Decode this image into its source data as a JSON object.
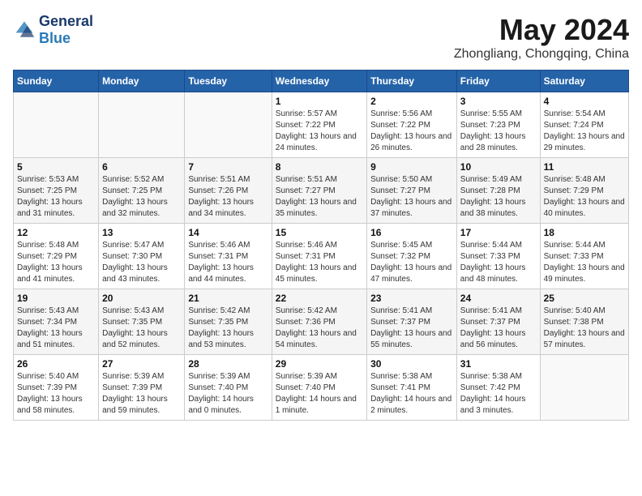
{
  "header": {
    "logo_general": "General",
    "logo_blue": "Blue",
    "month": "May 2024",
    "location": "Zhongliang, Chongqing, China"
  },
  "weekdays": [
    "Sunday",
    "Monday",
    "Tuesday",
    "Wednesday",
    "Thursday",
    "Friday",
    "Saturday"
  ],
  "weeks": [
    [
      {
        "day": "",
        "sunrise": "",
        "sunset": "",
        "daylight": ""
      },
      {
        "day": "",
        "sunrise": "",
        "sunset": "",
        "daylight": ""
      },
      {
        "day": "",
        "sunrise": "",
        "sunset": "",
        "daylight": ""
      },
      {
        "day": "1",
        "sunrise": "Sunrise: 5:57 AM",
        "sunset": "Sunset: 7:22 PM",
        "daylight": "Daylight: 13 hours and 24 minutes."
      },
      {
        "day": "2",
        "sunrise": "Sunrise: 5:56 AM",
        "sunset": "Sunset: 7:22 PM",
        "daylight": "Daylight: 13 hours and 26 minutes."
      },
      {
        "day": "3",
        "sunrise": "Sunrise: 5:55 AM",
        "sunset": "Sunset: 7:23 PM",
        "daylight": "Daylight: 13 hours and 28 minutes."
      },
      {
        "day": "4",
        "sunrise": "Sunrise: 5:54 AM",
        "sunset": "Sunset: 7:24 PM",
        "daylight": "Daylight: 13 hours and 29 minutes."
      }
    ],
    [
      {
        "day": "5",
        "sunrise": "Sunrise: 5:53 AM",
        "sunset": "Sunset: 7:25 PM",
        "daylight": "Daylight: 13 hours and 31 minutes."
      },
      {
        "day": "6",
        "sunrise": "Sunrise: 5:52 AM",
        "sunset": "Sunset: 7:25 PM",
        "daylight": "Daylight: 13 hours and 32 minutes."
      },
      {
        "day": "7",
        "sunrise": "Sunrise: 5:51 AM",
        "sunset": "Sunset: 7:26 PM",
        "daylight": "Daylight: 13 hours and 34 minutes."
      },
      {
        "day": "8",
        "sunrise": "Sunrise: 5:51 AM",
        "sunset": "Sunset: 7:27 PM",
        "daylight": "Daylight: 13 hours and 35 minutes."
      },
      {
        "day": "9",
        "sunrise": "Sunrise: 5:50 AM",
        "sunset": "Sunset: 7:27 PM",
        "daylight": "Daylight: 13 hours and 37 minutes."
      },
      {
        "day": "10",
        "sunrise": "Sunrise: 5:49 AM",
        "sunset": "Sunset: 7:28 PM",
        "daylight": "Daylight: 13 hours and 38 minutes."
      },
      {
        "day": "11",
        "sunrise": "Sunrise: 5:48 AM",
        "sunset": "Sunset: 7:29 PM",
        "daylight": "Daylight: 13 hours and 40 minutes."
      }
    ],
    [
      {
        "day": "12",
        "sunrise": "Sunrise: 5:48 AM",
        "sunset": "Sunset: 7:29 PM",
        "daylight": "Daylight: 13 hours and 41 minutes."
      },
      {
        "day": "13",
        "sunrise": "Sunrise: 5:47 AM",
        "sunset": "Sunset: 7:30 PM",
        "daylight": "Daylight: 13 hours and 43 minutes."
      },
      {
        "day": "14",
        "sunrise": "Sunrise: 5:46 AM",
        "sunset": "Sunset: 7:31 PM",
        "daylight": "Daylight: 13 hours and 44 minutes."
      },
      {
        "day": "15",
        "sunrise": "Sunrise: 5:46 AM",
        "sunset": "Sunset: 7:31 PM",
        "daylight": "Daylight: 13 hours and 45 minutes."
      },
      {
        "day": "16",
        "sunrise": "Sunrise: 5:45 AM",
        "sunset": "Sunset: 7:32 PM",
        "daylight": "Daylight: 13 hours and 47 minutes."
      },
      {
        "day": "17",
        "sunrise": "Sunrise: 5:44 AM",
        "sunset": "Sunset: 7:33 PM",
        "daylight": "Daylight: 13 hours and 48 minutes."
      },
      {
        "day": "18",
        "sunrise": "Sunrise: 5:44 AM",
        "sunset": "Sunset: 7:33 PM",
        "daylight": "Daylight: 13 hours and 49 minutes."
      }
    ],
    [
      {
        "day": "19",
        "sunrise": "Sunrise: 5:43 AM",
        "sunset": "Sunset: 7:34 PM",
        "daylight": "Daylight: 13 hours and 51 minutes."
      },
      {
        "day": "20",
        "sunrise": "Sunrise: 5:43 AM",
        "sunset": "Sunset: 7:35 PM",
        "daylight": "Daylight: 13 hours and 52 minutes."
      },
      {
        "day": "21",
        "sunrise": "Sunrise: 5:42 AM",
        "sunset": "Sunset: 7:35 PM",
        "daylight": "Daylight: 13 hours and 53 minutes."
      },
      {
        "day": "22",
        "sunrise": "Sunrise: 5:42 AM",
        "sunset": "Sunset: 7:36 PM",
        "daylight": "Daylight: 13 hours and 54 minutes."
      },
      {
        "day": "23",
        "sunrise": "Sunrise: 5:41 AM",
        "sunset": "Sunset: 7:37 PM",
        "daylight": "Daylight: 13 hours and 55 minutes."
      },
      {
        "day": "24",
        "sunrise": "Sunrise: 5:41 AM",
        "sunset": "Sunset: 7:37 PM",
        "daylight": "Daylight: 13 hours and 56 minutes."
      },
      {
        "day": "25",
        "sunrise": "Sunrise: 5:40 AM",
        "sunset": "Sunset: 7:38 PM",
        "daylight": "Daylight: 13 hours and 57 minutes."
      }
    ],
    [
      {
        "day": "26",
        "sunrise": "Sunrise: 5:40 AM",
        "sunset": "Sunset: 7:39 PM",
        "daylight": "Daylight: 13 hours and 58 minutes."
      },
      {
        "day": "27",
        "sunrise": "Sunrise: 5:39 AM",
        "sunset": "Sunset: 7:39 PM",
        "daylight": "Daylight: 13 hours and 59 minutes."
      },
      {
        "day": "28",
        "sunrise": "Sunrise: 5:39 AM",
        "sunset": "Sunset: 7:40 PM",
        "daylight": "Daylight: 14 hours and 0 minutes."
      },
      {
        "day": "29",
        "sunrise": "Sunrise: 5:39 AM",
        "sunset": "Sunset: 7:40 PM",
        "daylight": "Daylight: 14 hours and 1 minute."
      },
      {
        "day": "30",
        "sunrise": "Sunrise: 5:38 AM",
        "sunset": "Sunset: 7:41 PM",
        "daylight": "Daylight: 14 hours and 2 minutes."
      },
      {
        "day": "31",
        "sunrise": "Sunrise: 5:38 AM",
        "sunset": "Sunset: 7:42 PM",
        "daylight": "Daylight: 14 hours and 3 minutes."
      },
      {
        "day": "",
        "sunrise": "",
        "sunset": "",
        "daylight": ""
      }
    ]
  ]
}
